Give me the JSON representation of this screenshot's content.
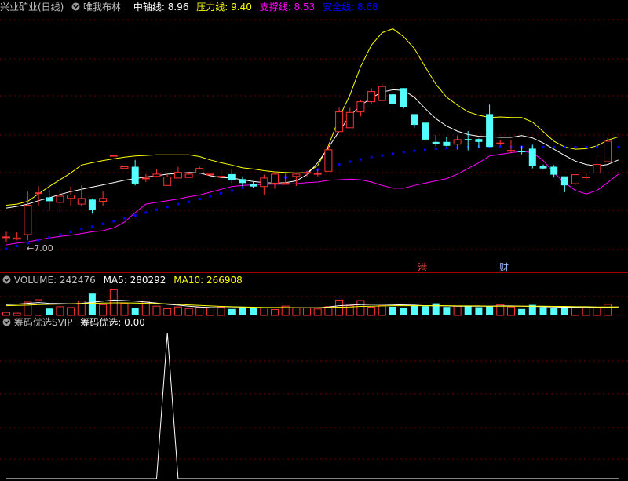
{
  "header_main": {
    "stock_name": "兴业矿业(日线)",
    "indicator_name": "唯我布林",
    "mid_label": "中轴线: 8.96",
    "upper_label": "压力线: 9.40",
    "support_label": "支撑线: 8.53",
    "safe_label": "安全线: 8.68",
    "colors": {
      "stock": "#c0c0c0",
      "mid": "#ffffff",
      "upper": "#ffff00",
      "support": "#ff00ff",
      "safe": "#0000ff"
    }
  },
  "header_volume": {
    "volume_label": "VOLUME: 242476",
    "ma5_label": "MA5: 280292",
    "ma10_label": "MA10: 266908"
  },
  "header_chip": {
    "name": "筹码优选SVIP",
    "value_label": "筹码优选: 0.00"
  },
  "annotations": {
    "low_label": "←7.00",
    "marker_1": "港",
    "marker_2": "财"
  },
  "chart_data": {
    "type": "candlestick",
    "price_ylim": [
      6.7,
      11.0
    ],
    "up_color": "#ff3232",
    "down_color": "#54ffff",
    "candles": [
      {
        "o": 7.09,
        "h": 7.18,
        "l": 7.0,
        "c": 7.09
      },
      {
        "o": 7.05,
        "h": 7.17,
        "l": 7.03,
        "c": 7.07
      },
      {
        "o": 7.13,
        "h": 7.89,
        "l": 7.03,
        "c": 7.65
      },
      {
        "o": 7.86,
        "h": 7.99,
        "l": 7.65,
        "c": 7.87
      },
      {
        "o": 7.79,
        "h": 7.92,
        "l": 7.55,
        "c": 7.72
      },
      {
        "o": 7.7,
        "h": 7.92,
        "l": 7.53,
        "c": 7.81
      },
      {
        "o": 7.77,
        "h": 7.98,
        "l": 7.64,
        "c": 7.83
      },
      {
        "o": 7.67,
        "h": 8.0,
        "l": 7.63,
        "c": 7.77
      },
      {
        "o": 7.75,
        "h": 7.77,
        "l": 7.5,
        "c": 7.57
      },
      {
        "o": 7.72,
        "h": 7.9,
        "l": 7.64,
        "c": 7.77
      },
      {
        "o": 8.53,
        "h": 8.53,
        "l": 8.53,
        "c": 8.53
      },
      {
        "o": 8.3,
        "h": 8.35,
        "l": 8.3,
        "c": 8.33
      },
      {
        "o": 8.33,
        "h": 8.45,
        "l": 8.0,
        "c": 8.03
      },
      {
        "o": 8.13,
        "h": 8.2,
        "l": 8.06,
        "c": 8.13
      },
      {
        "o": 8.16,
        "h": 8.28,
        "l": 8.14,
        "c": 8.2
      },
      {
        "o": 8.0,
        "h": 8.2,
        "l": 8.0,
        "c": 8.15
      },
      {
        "o": 8.13,
        "h": 8.33,
        "l": 8.13,
        "c": 8.23
      },
      {
        "o": 8.14,
        "h": 8.23,
        "l": 8.14,
        "c": 8.2
      },
      {
        "o": 8.22,
        "h": 8.33,
        "l": 8.2,
        "c": 8.3
      },
      {
        "o": 8.2,
        "h": 8.2,
        "l": 8.2,
        "c": 8.2
      },
      {
        "o": 8.16,
        "h": 8.28,
        "l": 8.04,
        "c": 8.16
      },
      {
        "o": 8.2,
        "h": 8.28,
        "l": 8.04,
        "c": 8.09
      },
      {
        "o": 8.11,
        "h": 8.16,
        "l": 7.98,
        "c": 8.04
      },
      {
        "o": 8.03,
        "h": 8.07,
        "l": 7.95,
        "c": 7.98
      },
      {
        "o": 7.98,
        "h": 8.19,
        "l": 7.84,
        "c": 8.13
      },
      {
        "o": 8.04,
        "h": 8.21,
        "l": 7.94,
        "c": 8.2
      },
      {
        "o": 8.02,
        "h": 8.21,
        "l": 8.02,
        "c": 8.04
      },
      {
        "o": 8.16,
        "h": 8.21,
        "l": 7.99,
        "c": 8.2
      },
      {
        "o": 8.22,
        "h": 8.26,
        "l": 8.16,
        "c": 8.23
      },
      {
        "o": 8.21,
        "h": 8.29,
        "l": 8.16,
        "c": 8.21
      },
      {
        "o": 8.25,
        "h": 8.7,
        "l": 8.25,
        "c": 8.63
      },
      {
        "o": 8.95,
        "h": 9.37,
        "l": 8.95,
        "c": 9.3
      },
      {
        "o": 9.02,
        "h": 9.37,
        "l": 9.02,
        "c": 9.29
      },
      {
        "o": 9.3,
        "h": 9.51,
        "l": 9.22,
        "c": 9.48
      },
      {
        "o": 9.48,
        "h": 9.72,
        "l": 9.43,
        "c": 9.66
      },
      {
        "o": 9.5,
        "h": 9.79,
        "l": 9.5,
        "c": 9.75
      },
      {
        "o": 9.61,
        "h": 9.8,
        "l": 9.38,
        "c": 9.44
      },
      {
        "o": 9.72,
        "h": 9.72,
        "l": 9.36,
        "c": 9.39
      },
      {
        "o": 9.26,
        "h": 9.26,
        "l": 9.02,
        "c": 9.07
      },
      {
        "o": 9.11,
        "h": 9.24,
        "l": 8.74,
        "c": 8.81
      },
      {
        "o": 8.77,
        "h": 8.89,
        "l": 8.69,
        "c": 8.74
      },
      {
        "o": 8.77,
        "h": 8.86,
        "l": 8.69,
        "c": 8.7
      },
      {
        "o": 8.73,
        "h": 8.88,
        "l": 8.63,
        "c": 8.81
      },
      {
        "o": 8.82,
        "h": 8.96,
        "l": 8.62,
        "c": 8.8
      },
      {
        "o": 8.82,
        "h": 8.83,
        "l": 8.66,
        "c": 8.77
      },
      {
        "o": 9.26,
        "h": 9.43,
        "l": 8.68,
        "c": 8.68
      },
      {
        "o": 8.75,
        "h": 8.8,
        "l": 8.71,
        "c": 8.75
      },
      {
        "o": 8.62,
        "h": 8.8,
        "l": 8.57,
        "c": 8.62
      },
      {
        "o": 8.6,
        "h": 8.7,
        "l": 8.55,
        "c": 8.59
      },
      {
        "o": 8.65,
        "h": 8.72,
        "l": 8.3,
        "c": 8.35
      },
      {
        "o": 8.34,
        "h": 8.37,
        "l": 8.28,
        "c": 8.3
      },
      {
        "o": 8.33,
        "h": 8.36,
        "l": 8.14,
        "c": 8.19
      },
      {
        "o": 8.16,
        "h": 8.16,
        "l": 7.88,
        "c": 8.0
      },
      {
        "o": 8.03,
        "h": 8.19,
        "l": 8.01,
        "c": 8.19
      },
      {
        "o": 8.15,
        "h": 8.22,
        "l": 8.08,
        "c": 8.15
      },
      {
        "o": 8.22,
        "h": 8.53,
        "l": 8.22,
        "c": 8.37
      },
      {
        "o": 8.42,
        "h": 8.84,
        "l": 8.42,
        "c": 8.78
      }
    ],
    "upper": [
      7.65,
      7.67,
      7.72,
      7.85,
      7.98,
      8.1,
      8.22,
      8.36,
      8.4,
      8.44,
      8.47,
      8.5,
      8.52,
      8.53,
      8.54,
      8.54,
      8.54,
      8.54,
      8.51,
      8.45,
      8.4,
      8.36,
      8.31,
      8.29,
      8.26,
      8.24,
      8.23,
      8.22,
      8.23,
      8.35,
      8.7,
      9.2,
      9.6,
      10.1,
      10.48,
      10.7,
      10.77,
      10.63,
      10.42,
      10.1,
      9.79,
      9.56,
      9.42,
      9.3,
      9.24,
      9.2,
      9.21,
      9.2,
      9.2,
      9.12,
      8.95,
      8.78,
      8.68,
      8.64,
      8.65,
      8.7,
      8.8,
      8.86
    ],
    "mid": [
      7.6,
      7.63,
      7.67,
      7.73,
      7.78,
      7.84,
      7.89,
      7.93,
      7.97,
      8.01,
      8.05,
      8.09,
      8.12,
      8.15,
      8.17,
      8.2,
      8.21,
      8.23,
      8.22,
      8.17,
      8.14,
      8.13,
      8.1,
      8.07,
      8.05,
      8.04,
      8.05,
      8.08,
      8.19,
      8.4,
      8.67,
      8.96,
      9.23,
      9.41,
      9.55,
      9.65,
      9.69,
      9.68,
      9.56,
      9.36,
      9.18,
      9.05,
      8.96,
      8.9,
      8.87,
      8.86,
      8.85,
      8.85,
      8.88,
      8.84,
      8.75,
      8.64,
      8.53,
      8.43,
      8.37,
      8.34,
      8.37,
      8.45
    ],
    "support": [
      6.95,
      6.98,
      7.0,
      7.04,
      7.07,
      7.1,
      7.12,
      7.15,
      7.18,
      7.2,
      7.25,
      7.35,
      7.52,
      7.67,
      7.7,
      7.73,
      7.76,
      7.8,
      7.83,
      7.88,
      7.93,
      7.98,
      8.0,
      8.01,
      8.02,
      8.02,
      8.02,
      8.03,
      8.05,
      8.06,
      8.09,
      8.1,
      8.11,
      8.1,
      8.06,
      8.0,
      7.95,
      7.95,
      8.0,
      8.04,
      8.08,
      8.12,
      8.2,
      8.3,
      8.4,
      8.52,
      8.55,
      8.58,
      8.6,
      8.58,
      8.44,
      8.22,
      8.05,
      7.91,
      7.85,
      7.91,
      8.05,
      8.2
    ],
    "safe": [
      6.88,
      6.93,
      6.98,
      7.03,
      7.08,
      7.13,
      7.18,
      7.23,
      7.27,
      7.32,
      7.37,
      7.42,
      7.47,
      7.52,
      7.57,
      7.62,
      7.67,
      7.71,
      7.76,
      7.81,
      7.86,
      7.91,
      7.96,
      8.0,
      8.05,
      8.1,
      8.14,
      8.19,
      8.23,
      8.28,
      8.33,
      8.37,
      8.42,
      8.46,
      8.5,
      8.53,
      8.56,
      8.59,
      8.61,
      8.63,
      8.65,
      8.66,
      8.67,
      8.68,
      8.69,
      8.69,
      8.69,
      8.68,
      8.68,
      8.68,
      8.68,
      8.68,
      8.68,
      8.68,
      8.68,
      8.68,
      8.68,
      8.68
    ],
    "volume": [
      120,
      90,
      520,
      610,
      270,
      340,
      310,
      560,
      850,
      420,
      1020,
      460,
      300,
      560,
      360,
      260,
      330,
      270,
      320,
      290,
      320,
      250,
      340,
      280,
      290,
      230,
      360,
      300,
      290,
      250,
      340,
      600,
      380,
      580,
      320,
      380,
      340,
      310,
      370,
      360,
      470,
      330,
      360,
      380,
      320,
      360,
      420,
      330,
      250,
      410,
      320,
      300,
      350,
      330,
      290,
      300,
      430,
      420
    ],
    "volume_ylim": [
      0,
      1100
    ],
    "ma5": [
      420,
      440,
      470,
      500,
      470,
      460,
      450,
      470,
      510,
      560,
      600,
      580,
      560,
      520,
      480,
      430,
      400,
      360,
      330,
      310,
      300,
      300,
      300,
      300,
      300,
      300,
      300,
      300,
      300,
      300,
      330,
      380,
      400,
      420,
      430,
      430,
      420,
      410,
      400,
      380,
      380,
      370,
      360,
      360,
      360,
      360,
      370,
      370,
      360,
      350,
      340,
      330,
      320,
      320,
      310,
      310,
      320,
      330
    ],
    "ma10": [
      380,
      390,
      400,
      420,
      430,
      440,
      450,
      460,
      470,
      480,
      490,
      490,
      480,
      470,
      460,
      450,
      430,
      410,
      390,
      370,
      350,
      340,
      330,
      320,
      310,
      310,
      310,
      300,
      300,
      300,
      310,
      320,
      330,
      350,
      360,
      370,
      380,
      380,
      380,
      380,
      380,
      380,
      370,
      370,
      370,
      360,
      360,
      360,
      360,
      360,
      360,
      350,
      350,
      340,
      340,
      330,
      330,
      330
    ],
    "chip_values": [
      0,
      0,
      0,
      0,
      0,
      0,
      0,
      0,
      0,
      0,
      0,
      0,
      0,
      0,
      0,
      1,
      0,
      0,
      0,
      0,
      0,
      0,
      0,
      0,
      0,
      0,
      0,
      0,
      0,
      0,
      0,
      0,
      0,
      0,
      0,
      0,
      0,
      0,
      0,
      0,
      0,
      0,
      0,
      0,
      0,
      0,
      0,
      0,
      0,
      0,
      0,
      0,
      0,
      0,
      0,
      0,
      0,
      0
    ],
    "chip_ylim": [
      0,
      1
    ]
  }
}
